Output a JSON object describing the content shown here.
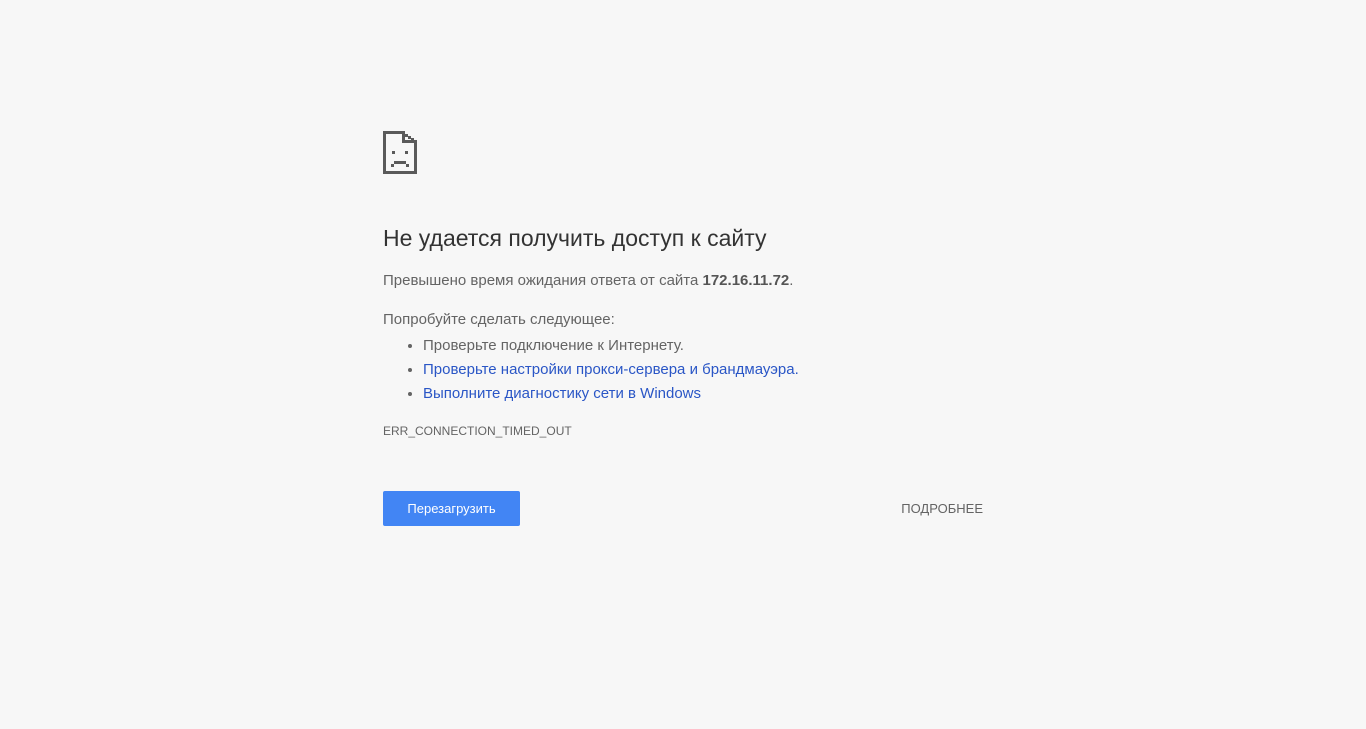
{
  "error": {
    "icon": "sad-page-icon",
    "title": "Не удается получить доступ к сайту",
    "summary_prefix": "Превышено время ожидания ответа от сайта ",
    "host": "172.16.11.72",
    "summary_suffix": ".",
    "suggestions_heading": "Попробуйте сделать следующее:",
    "suggestions": [
      {
        "text": "Проверьте подключение к Интернету.",
        "is_link": false
      },
      {
        "text": "Проверьте настройки прокси-сервера и брандмауэра.",
        "is_link": true
      },
      {
        "text": "Выполните диагностику сети в Windows",
        "is_link": true
      }
    ],
    "code": "ERR_CONNECTION_TIMED_OUT"
  },
  "buttons": {
    "reload_label": "Перезагрузить",
    "details_label": "ПОДРОБНЕЕ"
  },
  "colors": {
    "background": "#f7f7f7",
    "primary_button": "#4285f4",
    "link": "#2a56c6",
    "title": "#333333",
    "text": "#646464"
  }
}
